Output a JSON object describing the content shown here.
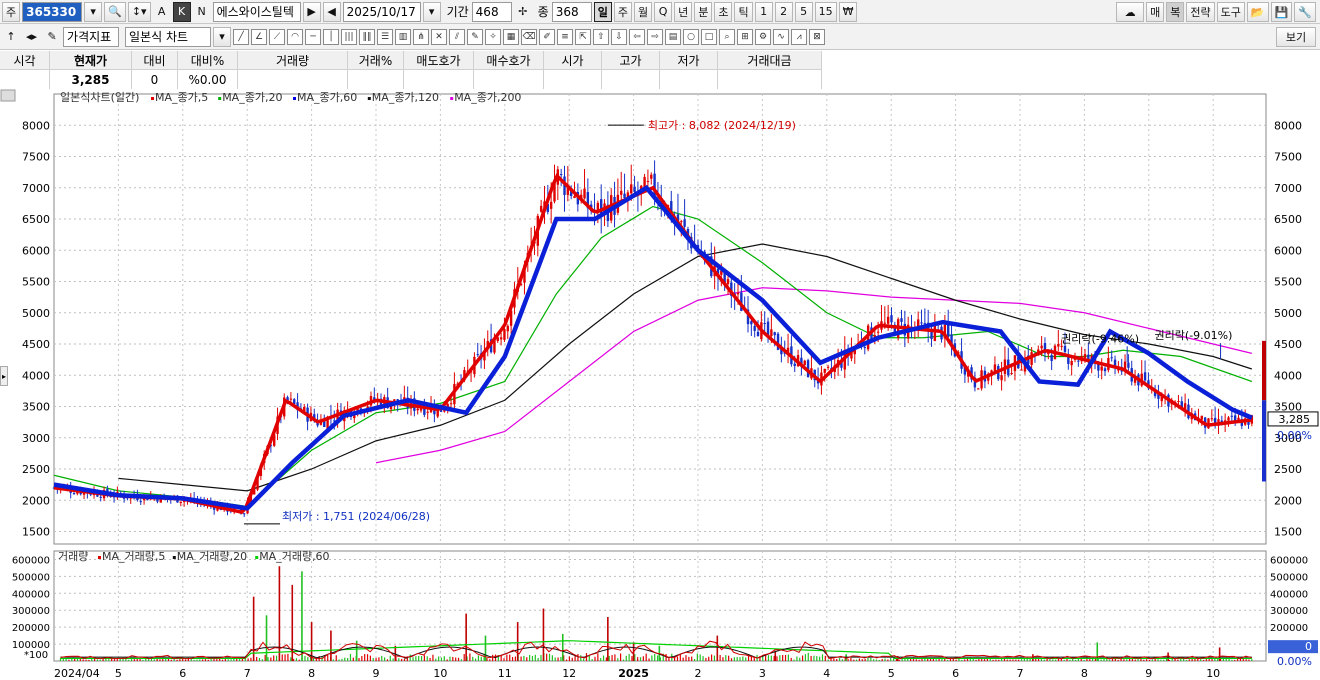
{
  "toolbar1": {
    "market_label": "주",
    "stock_code": "365330",
    "stock_name": "에스와이스틸텍",
    "date": "2025/10/17",
    "period_label": "기간",
    "period_value": "468",
    "count_label": "종",
    "count_value": "368",
    "intervals": [
      "일",
      "주",
      "월",
      "Q",
      "년",
      "분",
      "초",
      "틱",
      "1",
      "2",
      "5",
      "15",
      "₩"
    ],
    "right_buttons": [
      "매",
      "복",
      "전략",
      "도구"
    ]
  },
  "toolbar2": {
    "indicator_button": "가격지표",
    "chart_type": "일본식 차트",
    "view_button": "보기"
  },
  "quote": {
    "headers": [
      "시각",
      "현재가",
      "대비",
      "대비%",
      "거래량",
      "거래%",
      "매도호가",
      "매수호가",
      "시가",
      "고가",
      "저가",
      "거래대금"
    ],
    "values": [
      "",
      "3,285",
      "0",
      "%0.00",
      "",
      "",
      "",
      "",
      "",
      "",
      "",
      ""
    ]
  },
  "chart_data": [
    {
      "type": "line",
      "title": "일본식차트(일간)",
      "legend": [
        {
          "name": "MA_종가,5",
          "color": "#e00000"
        },
        {
          "name": "MA_종가,20",
          "color": "#00b000"
        },
        {
          "name": "MA_종가,60",
          "color": "#0000e0"
        },
        {
          "name": "MA_종가,120",
          "color": "#111111"
        },
        {
          "name": "MA_종가,200",
          "color": "#e000e0"
        }
      ],
      "x_ticks": [
        "2024/04",
        "5",
        "6",
        "7",
        "8",
        "9",
        "10",
        "11",
        "12",
        "2025",
        "2",
        "3",
        "4",
        "5",
        "6",
        "7",
        "8",
        "9",
        "10"
      ],
      "y_ticks": [
        1500,
        2000,
        2500,
        3000,
        3500,
        4000,
        4500,
        5000,
        5500,
        6000,
        6500,
        7000,
        7500,
        8000
      ],
      "ylim": [
        1300,
        8500
      ],
      "x_months": [
        0,
        1,
        2,
        3,
        4,
        5,
        6,
        7,
        8,
        9,
        10,
        11,
        12,
        13,
        14,
        15,
        16,
        17,
        18,
        18.6
      ],
      "close": [
        2200,
        2070,
        2020,
        1800,
        3600,
        3250,
        3600,
        3450,
        4800,
        7200,
        6600,
        7000,
        6000,
        4700,
        3900,
        4800,
        4700,
        3900,
        4400,
        4100,
        3200,
        3285
      ],
      "close_x": [
        0,
        1,
        2,
        2.95,
        3.6,
        4.1,
        5,
        6,
        7,
        7.8,
        8.4,
        9.3,
        10,
        11,
        11.9,
        12.8,
        13.8,
        14.3,
        15.4,
        16.6,
        17.9,
        18.6
      ],
      "series": [
        {
          "name": "MA_종가,60",
          "x": [
            0,
            1,
            2,
            3,
            3.7,
            4.5,
            5.5,
            6.4,
            7,
            7.8,
            8.4,
            9.2,
            10,
            11,
            11.9,
            12.8,
            13.8,
            14.7,
            15.3,
            15.9,
            16.4,
            17,
            17.6,
            18.3,
            18.6
          ],
          "values": [
            2250,
            2080,
            2030,
            1870,
            2600,
            3350,
            3600,
            3400,
            4300,
            6500,
            6500,
            7000,
            6000,
            5200,
            4200,
            4600,
            4850,
            4700,
            3900,
            3850,
            4700,
            4350,
            3900,
            3450,
            3320
          ]
        },
        {
          "name": "MA_종가,20",
          "x": [
            0,
            1,
            2,
            3,
            4,
            5,
            6,
            7,
            7.8,
            8.5,
            9.3,
            10,
            11,
            12,
            12.8,
            13.5,
            14.5,
            15.4,
            16,
            16.6,
            17.5,
            18.6
          ],
          "values": [
            2400,
            2150,
            2050,
            1900,
            2800,
            3400,
            3550,
            3900,
            5300,
            6200,
            6700,
            6500,
            5800,
            5000,
            4600,
            4600,
            4700,
            4300,
            4300,
            4400,
            4300,
            3900
          ]
        },
        {
          "name": "MA_종가,120",
          "x": [
            1,
            2,
            3,
            4,
            5,
            6,
            7,
            8,
            9,
            10,
            11,
            12,
            13,
            14,
            15,
            16,
            17,
            18,
            18.6
          ],
          "values": [
            2350,
            2250,
            2150,
            2500,
            2950,
            3200,
            3600,
            4500,
            5300,
            5900,
            6100,
            5900,
            5550,
            5200,
            4900,
            4650,
            4500,
            4300,
            4100
          ]
        },
        {
          "name": "MA_종가,200",
          "x": [
            5,
            6,
            7,
            8,
            9,
            10,
            11,
            12,
            13,
            14,
            15,
            16,
            17,
            18,
            18.6
          ],
          "values": [
            2600,
            2800,
            3100,
            3900,
            4700,
            5200,
            5400,
            5350,
            5250,
            5200,
            5150,
            5000,
            4750,
            4500,
            4350
          ]
        }
      ],
      "annotations": [
        {
          "text": "최고가 : 8,082 (2024/12/19)",
          "x": 8.6,
          "value": 8082
        },
        {
          "text": "최저가 : 1,751 (2024/06/28)",
          "x": 2.95,
          "value": 1751
        },
        {
          "text": "권리락(-9.46%)",
          "x": 15.95,
          "value": 4400
        },
        {
          "text": "권리락(-9.01%)",
          "x": 17.4,
          "value": 4450
        }
      ],
      "current_price": "3,285",
      "current_change": "0.00%"
    },
    {
      "type": "bar",
      "title": "거래량",
      "legend": [
        {
          "name": "MA_거래량,5",
          "color": "#e00000"
        },
        {
          "name": "MA_거래량,20",
          "color": "#111111"
        },
        {
          "name": "MA_거래량,60",
          "color": "#00d000"
        }
      ],
      "scale_label": "*100",
      "y_ticks": [
        100000,
        200000,
        300000,
        400000,
        500000,
        600000
      ],
      "ylim": [
        0,
        650000
      ],
      "x": [
        3.1,
        3.3,
        3.5,
        3.7,
        3.85,
        4.0,
        4.3,
        4.7,
        5.3,
        6.4,
        6.7,
        7.2,
        7.6,
        7.9,
        8.6,
        9.0,
        9.4,
        10.3,
        11.2,
        12.3,
        13.1,
        15.2,
        16.2,
        17.3,
        18.1
      ],
      "values": [
        380000,
        270000,
        560000,
        450000,
        530000,
        230000,
        180000,
        120000,
        90000,
        280000,
        150000,
        230000,
        310000,
        160000,
        260000,
        110000,
        90000,
        150000,
        60000,
        40000,
        30000,
        40000,
        110000,
        50000,
        80000
      ],
      "current_volume": "0",
      "current_change": "0.00%"
    }
  ]
}
